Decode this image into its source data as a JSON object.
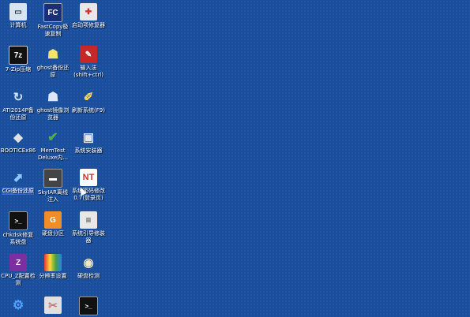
{
  "desktop": {
    "icons": [
      {
        "label": "计算机",
        "icon": "computer-icon"
      },
      {
        "label": "FastCopy极\n速复制",
        "icon": "fastcopy-icon"
      },
      {
        "label": "启动项修复器",
        "icon": "toolbox-icon"
      },
      {
        "label": "7-Zip压缩",
        "icon": "7zip-icon"
      },
      {
        "label": "ghost备份还\n原",
        "icon": "ghost-icon"
      },
      {
        "label": "输入法\n(shift+ctrl)",
        "icon": "input-method-icon"
      },
      {
        "label": "ATI2014P备\n份还原",
        "icon": "ati-icon"
      },
      {
        "label": "ghost镜像浏\n览器",
        "icon": "ghost-browser-icon"
      },
      {
        "label": "刷新系统(F9)",
        "icon": "broom-icon"
      },
      {
        "label": "BOOTICEx86",
        "icon": "bootice-icon"
      },
      {
        "label": "MemTest\nDeluxe内...",
        "icon": "memtest-icon"
      },
      {
        "label": "系统安装器",
        "icon": "installer-icon"
      },
      {
        "label": "CGI备份还原",
        "icon": "cgi-icon"
      },
      {
        "label": "SkyIAR离线\n注入",
        "icon": "skyiar-icon"
      },
      {
        "label": "系统密码修改\n0.7(登录页)",
        "icon": "nt-password-icon"
      },
      {
        "label": "chkdsk修复\n系统盘",
        "icon": "terminal-icon"
      },
      {
        "label": "硬盘分区",
        "icon": "diskgenius-icon"
      },
      {
        "label": "系统引导修装\n器",
        "icon": "boot-repair-icon"
      },
      {
        "label": "CPU_Z配置检\n测",
        "icon": "cpuz-icon"
      },
      {
        "label": "分辨率设置",
        "icon": "resolution-icon"
      },
      {
        "label": "硬盘检测",
        "icon": "disk-check-icon"
      },
      {
        "label": "",
        "icon": "gears-icon"
      },
      {
        "label": "",
        "icon": "tools-icon"
      },
      {
        "label": "",
        "icon": "console-icon"
      }
    ],
    "selected_label": "CGI备份还原"
  }
}
